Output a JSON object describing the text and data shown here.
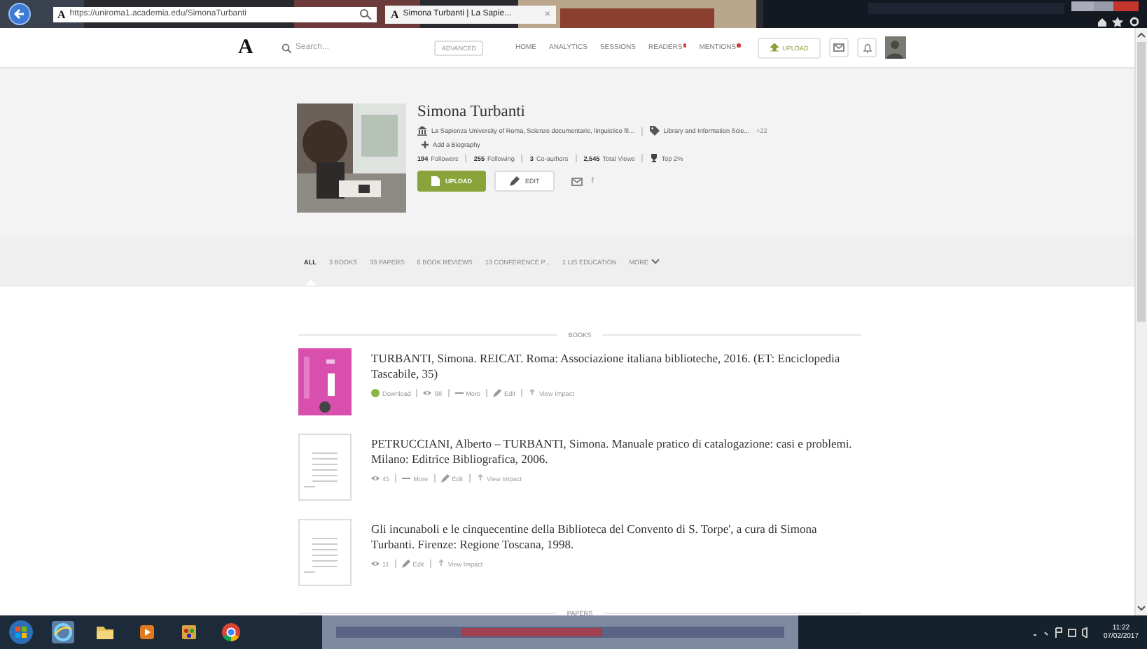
{
  "browser": {
    "address_icon": "A",
    "tab_icon": "A",
    "url": "https://uniroma1.academia.edu/SimonaTurbanti",
    "tab_title": "Simona Turbanti | La Sapie...",
    "tab_close": "×"
  },
  "nav": {
    "logo": "A",
    "search": {
      "placeholder": "Search..."
    },
    "advanced": "ADVANCED",
    "links": [
      {
        "label": "HOME",
        "alert": false
      },
      {
        "label": "ANALYTICS",
        "alert": false
      },
      {
        "label": "SESSIONS",
        "alert": false
      },
      {
        "label": "READERS",
        "alert": true
      },
      {
        "label": "MENTIONS",
        "alert": true
      }
    ],
    "upload": "UPLOAD"
  },
  "profile": {
    "name": "Simona Turbanti",
    "affiliation": "La Sapienza University of Roma, Scienze documentarie, linguistico fil...",
    "interests": "Library and Information Scie...",
    "more_interests": "+22",
    "add_bio": "Add a Biography",
    "stats": [
      {
        "count": "194",
        "label": "Followers"
      },
      {
        "count": "255",
        "label": "Following"
      },
      {
        "count": "3",
        "label": "Co-authors"
      },
      {
        "count": "2,545",
        "label": "Total Views"
      },
      {
        "label": "Top 2%",
        "kind": "rank"
      }
    ],
    "upload": "UPLOAD",
    "edit": "EDIT",
    "facebook": "f"
  },
  "tabs": [
    {
      "label": "ALL",
      "selected": true
    },
    {
      "label": "3 BOOKS",
      "selected": false
    },
    {
      "label": "33 PAPERS",
      "selected": false
    },
    {
      "label": "6 BOOK REVIEWS",
      "selected": false
    },
    {
      "label": "13 CONFERENCE P...",
      "selected": false
    },
    {
      "label": "1 LIS EDUCATION",
      "selected": false
    },
    {
      "label": "MORE",
      "selected": false,
      "kind": "menu"
    }
  ],
  "sections": [
    {
      "heading": "BOOKS",
      "items": [
        {
          "kind": "cover",
          "title": "TURBANTI, Simona. REICAT. Roma: Associazione italiana biblioteche, 2016. (ET: Enciclopedia Tascabile, 35)",
          "actions": [
            {
              "kind": "download",
              "label": "Download"
            },
            {
              "kind": "views",
              "label": "98"
            },
            {
              "kind": "more",
              "label": "More"
            },
            {
              "kind": "edit",
              "label": "Edit"
            },
            {
              "kind": "impact",
              "label": "View Impact"
            }
          ]
        },
        {
          "kind": "blank",
          "title": "PETRUCCIANI, Alberto – TURBANTI, Simona. Manuale pratico di catalogazione: casi e problemi. Milano: Editrice Bibliografica, 2006.",
          "actions": [
            {
              "kind": "views",
              "label": "45"
            },
            {
              "kind": "more",
              "label": "More"
            },
            {
              "kind": "edit",
              "label": "Edit"
            },
            {
              "kind": "impact",
              "label": "View Impact"
            }
          ]
        },
        {
          "kind": "blank",
          "title": "Gli incunaboli e le cinquecentine della Biblioteca del Convento di S. Torpe', a cura di Simona Turbanti. Firenze: Regione Toscana, 1998.",
          "actions": [
            {
              "kind": "views",
              "label": "11"
            },
            {
              "kind": "edit",
              "label": "Edit"
            },
            {
              "kind": "impact",
              "label": "View Impact"
            }
          ]
        }
      ]
    },
    {
      "heading": "PAPERS"
    }
  ],
  "taskbar": {
    "apps": [
      {
        "kind": "start"
      },
      {
        "kind": "ie"
      },
      {
        "kind": "folder"
      },
      {
        "kind": "media"
      },
      {
        "kind": "paint"
      },
      {
        "kind": "chrome"
      }
    ],
    "time": "11:22",
    "date": "07/02/2017"
  }
}
